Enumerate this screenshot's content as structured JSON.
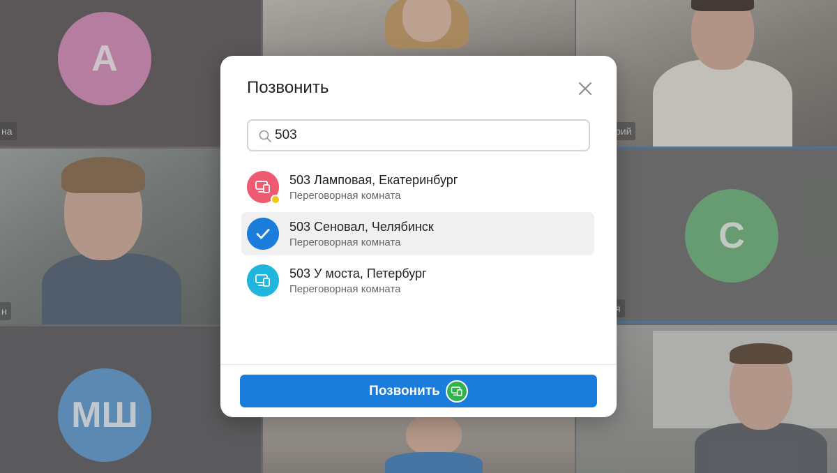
{
  "background_tiles": {
    "tile_a": {
      "initial": "А",
      "color": "#d98bbb",
      "name_fragment": "на"
    },
    "tile_c": {
      "initial": "С",
      "color": "#6db47b",
      "name_fragment": "я"
    },
    "tile_msh": {
      "initial": "МШ",
      "color": "#5d9bd5"
    },
    "tile_mid_left": {
      "name_fragment": "н"
    },
    "tile_top_right": {
      "name_fragment": "рий"
    }
  },
  "dialog": {
    "title": "Позвонить",
    "search": {
      "value": "503"
    },
    "results": [
      {
        "title": "503 Ламповая, Екатеринбург",
        "subtitle": "Переговорная комната",
        "icon": "room-device-icon",
        "icon_color": "#ee5a6f",
        "status": "away",
        "selected": false
      },
      {
        "title": "503 Сеновал, Челябинск",
        "subtitle": "Переговорная комната",
        "icon": "check-icon",
        "icon_color": "#1a7cdb",
        "selected": true
      },
      {
        "title": "503 У моста, Петербург",
        "subtitle": "Переговорная комната",
        "icon": "room-device-icon",
        "icon_color": "#1fb5dd",
        "selected": false
      }
    ],
    "call_button_label": "Позвонить",
    "accent_color": "#1a7cdb"
  }
}
